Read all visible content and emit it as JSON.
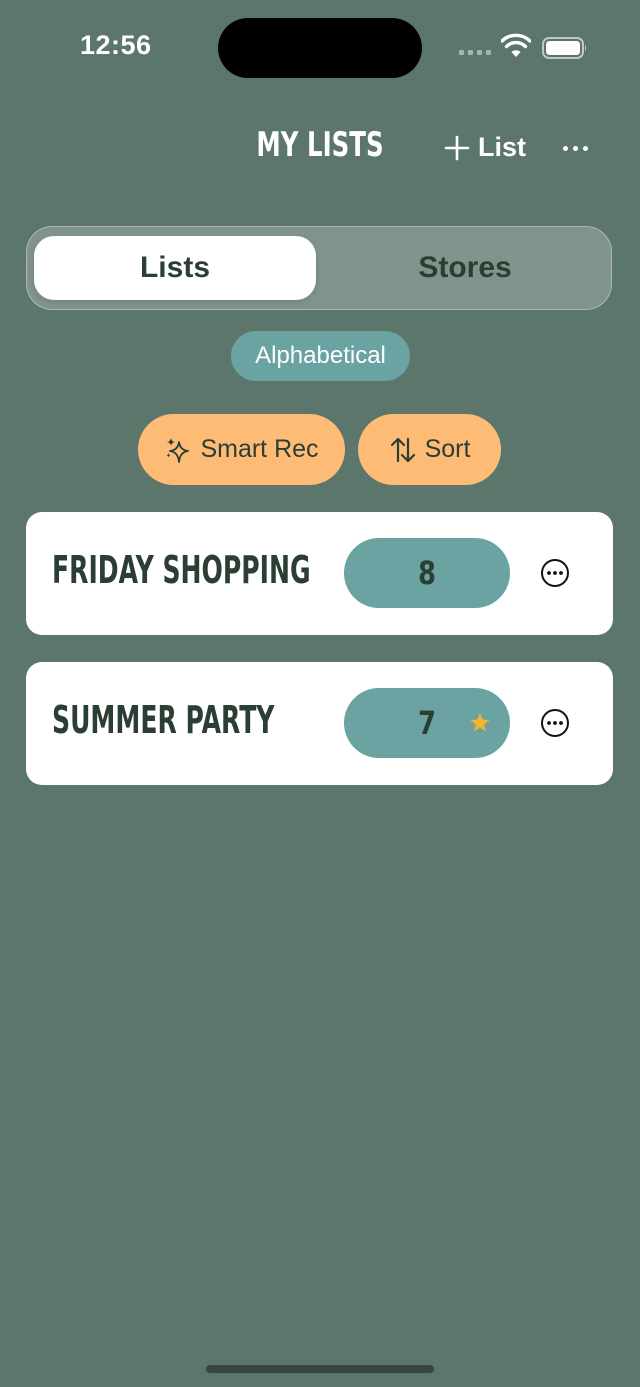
{
  "status_bar": {
    "time": "12:56"
  },
  "header": {
    "title": "MY LISTS",
    "add_list_label": "List",
    "add_icon": "plus-icon",
    "more_icon": "ellipsis-icon"
  },
  "segmented_control": {
    "tabs": [
      {
        "label": "Lists",
        "selected": true
      },
      {
        "label": "Stores",
        "selected": false
      }
    ]
  },
  "sort_chip": {
    "label": "Alphabetical"
  },
  "actions": {
    "smart_rec_label": "Smart Rec",
    "smart_rec_icon": "sparkles-icon",
    "sort_label": "Sort",
    "sort_icon": "arrow-up-down-icon"
  },
  "lists": [
    {
      "name": "FRIDAY SHOPPING",
      "count": "8",
      "starred": false
    },
    {
      "name": "SUMMER PARTY",
      "count": "7",
      "starred": true
    }
  ],
  "colors": {
    "background": "#5d766c",
    "accent_teal": "#6aa3a1",
    "accent_orange": "#fdbb76",
    "text_dark": "#2b3e34",
    "star": "#f5b331"
  }
}
